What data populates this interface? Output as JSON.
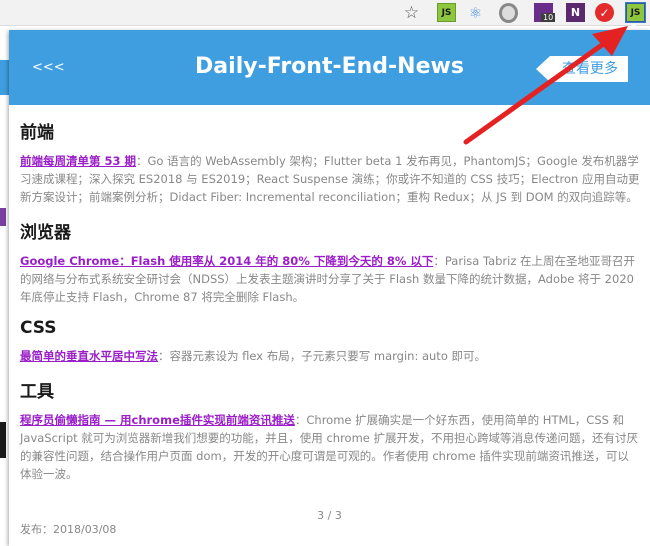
{
  "toolbar": {
    "star_glyph": "☆",
    "js_label": "JS",
    "react_glyph": "⚛",
    "badge_count": "10",
    "n_label": "N",
    "red_glyph": "✓",
    "js2_label": "JS"
  },
  "header": {
    "back_label": "<<<",
    "title": "Daily-Front-End-News",
    "more_label": "查看更多"
  },
  "sections": [
    {
      "title": "前端",
      "link": "前端每周清单第 53 期",
      "desc": "：Go 语言的 WebAssembly 架构；Flutter beta 1 发布再见，PhantomJS；Google 发布机器学习速成课程；深入探究 ES2018 与 ES2019；React Suspense 演练；你或许不知道的 CSS 技巧；Electron 应用自动更新方案设计；前端案例分析；Didact Fiber: Incremental reconciliation；重构 Redux；从 JS 到 DOM 的双向追踪等。"
    },
    {
      "title": "浏览器",
      "link": "Google Chrome：Flash 使用率从 2014 年的 80% 下降到今天的 8% 以下",
      "desc": "：Parisa Tabriz 在上周在圣地亚哥召开的网络与分布式系统安全研讨会（NDSS）上发表主题演讲时分享了关于 Flash 数量下降的统计数据，Adobe 将于 2020 年底停止支持 Flash，Chrome 87 将完全删除 Flash。"
    },
    {
      "title": "CSS",
      "link": "最简单的垂直水平居中写法",
      "desc": "：容器元素设为 flex 布局，子元素只要写 margin: auto 即可。"
    },
    {
      "title": "工具",
      "link": "程序员偷懒指南 — 用chrome插件实现前端资讯推送",
      "desc": "：Chrome 扩展确实是一个好东西，使用简单的 HTML，CSS 和 JavaScript 就可为浏览器新增我们想要的功能，并且，使用 chrome 扩展开发，不用担心跨域等消息传递问题，还有讨厌的兼容性问题，结合操作用户页面 dom，开发的开心度可谓是可观的。作者使用 chrome 插件实现前端资讯推送，可以体验一波。"
    }
  ],
  "footer": {
    "pager": "3 / 3",
    "date": "发布：2018/03/08"
  },
  "colors": {
    "header_bg": "#3f9ee0",
    "link": "#9b1fc9",
    "arrow": "#e52222"
  }
}
